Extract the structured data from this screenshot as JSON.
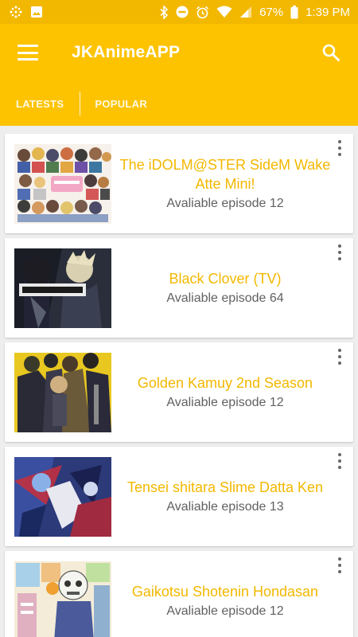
{
  "status_bar": {
    "battery_percent": "67%",
    "time": "1:39 PM",
    "icons": [
      "grid-dots-icon",
      "image-icon",
      "bluetooth-icon",
      "do-not-disturb-icon",
      "alarm-icon",
      "wifi-icon",
      "signal-icon",
      "battery-icon"
    ]
  },
  "app_bar": {
    "title": "JKAnimeAPP",
    "menu_icon": "hamburger-menu-icon",
    "search_icon": "search-icon"
  },
  "tabs": [
    {
      "label": "LATESTS",
      "selected": true
    },
    {
      "label": "POPULAR",
      "selected": false
    }
  ],
  "colors": {
    "primary": "#fdc300",
    "primary_dark": "#f2b800",
    "title_text": "#f2b800",
    "subtitle_text": "#616161",
    "background": "#eeeeee"
  },
  "anime": [
    {
      "title": "The iDOLM@STER SideM Wake Atte Mini!",
      "subtitle": "Avaliable episode 12"
    },
    {
      "title": "Black Clover (TV)",
      "subtitle": "Avaliable episode 64"
    },
    {
      "title": "Golden Kamuy 2nd Season",
      "subtitle": "Avaliable episode 12"
    },
    {
      "title": "Tensei shitara Slime Datta Ken",
      "subtitle": "Avaliable episode 13"
    },
    {
      "title": "Gaikotsu Shotenin Hondasan",
      "subtitle": "Avaliable episode 12"
    }
  ]
}
